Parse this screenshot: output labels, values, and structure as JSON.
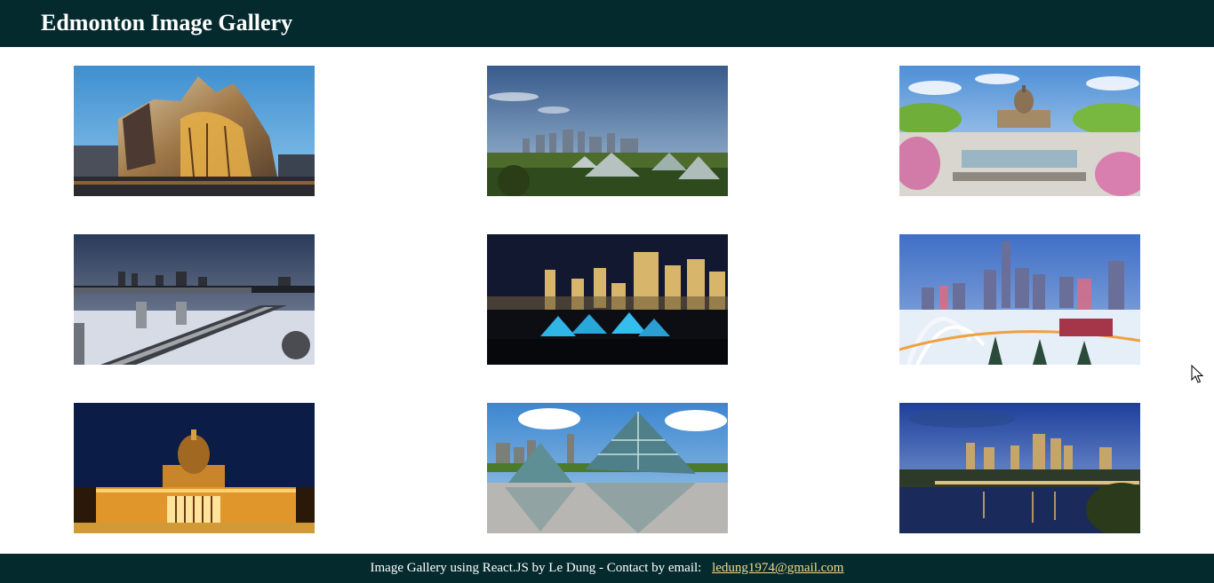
{
  "header": {
    "title": "Edmonton Image Gallery"
  },
  "gallery": {
    "images": [
      {
        "icon": "art-gallery-building-photo"
      },
      {
        "icon": "city-skyline-pyramids-photo"
      },
      {
        "icon": "legislature-gardens-photo"
      },
      {
        "icon": "bridge-winter-photo"
      },
      {
        "icon": "night-skyline-pyramids-photo"
      },
      {
        "icon": "walterdale-bridge-photo"
      },
      {
        "icon": "legislature-night-photo"
      },
      {
        "icon": "muttart-pyramids-photo"
      },
      {
        "icon": "river-skyline-dusk-photo"
      }
    ]
  },
  "footer": {
    "text": "Image Gallery using React.JS by Le Dung - Contact by email:",
    "email": "ledung1974@gmail.com"
  },
  "colors": {
    "header_bg": "#042a2e",
    "link": "#f3d98a"
  }
}
